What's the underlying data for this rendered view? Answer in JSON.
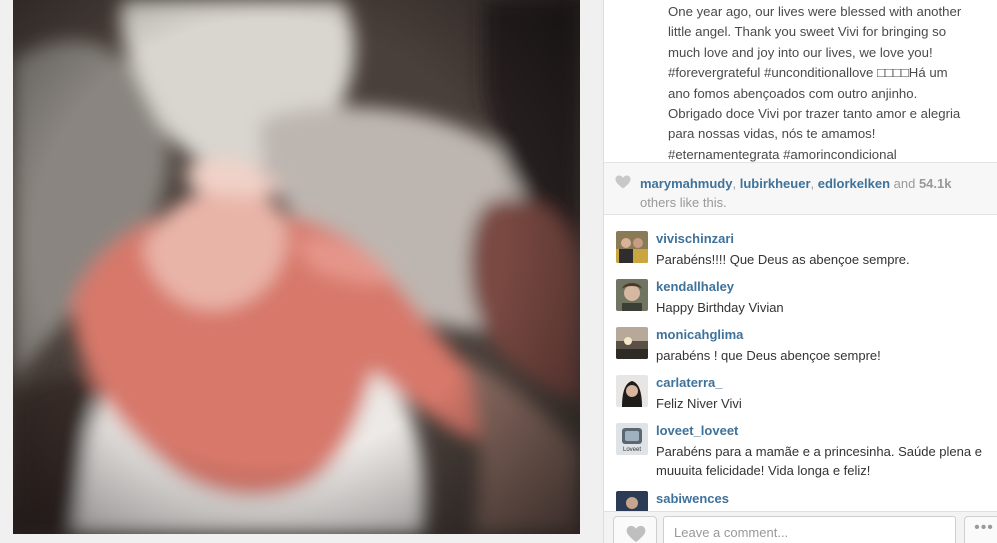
{
  "caption": {
    "lines": [
      "One year ago, our lives were blessed with another",
      "little angel. Thank you sweet Vivi for bringing so",
      "much love and joy into our lives, we love you!",
      "#forevergrateful #unconditionallove □□□□Há um",
      "ano fomos abençoados com outro anjinho.",
      "Obrigado doce Vivi por trazer tanto amor e alegria",
      "para nossas vidas, nós te amamos!",
      "#eternamentegrata #amorincondicional"
    ]
  },
  "likes": {
    "users": [
      "marymahmudy",
      "lubirkheuer",
      "edlorkelken"
    ],
    "sep": ", ",
    "and": " and ",
    "count": "54.1k",
    "suffix": "others like this."
  },
  "comments": [
    {
      "user": "vivischinzari",
      "text": "Parabéns!!!! Que Deus as abençoe sempre."
    },
    {
      "user": "kendallhaley",
      "text": "Happy Birthday Vivian"
    },
    {
      "user": "monicahglima",
      "text": "parabéns ! que Deus abençoe sempre!"
    },
    {
      "user": "carlaterra_",
      "text": "Feliz Niver Vivi"
    },
    {
      "user": "loveet_loveet",
      "text": "Parabéns para a mamãe e a princesinha. Saúde plena e muuuita felicidade! Vida longa e feliz!"
    },
    {
      "user": "sabiwences",
      "text": ""
    }
  ],
  "avatar_loveet_text": "Loveet",
  "comment_box": {
    "placeholder": "Leave a comment...",
    "more": "•••"
  },
  "colors": {
    "username": "#3f729b",
    "panel_bg": "#ffffff",
    "likes_bg": "#f7f7f7"
  },
  "icons": {
    "likes": "heart-icon",
    "like_button": "heart-icon",
    "more": "ellipsis-icon"
  }
}
